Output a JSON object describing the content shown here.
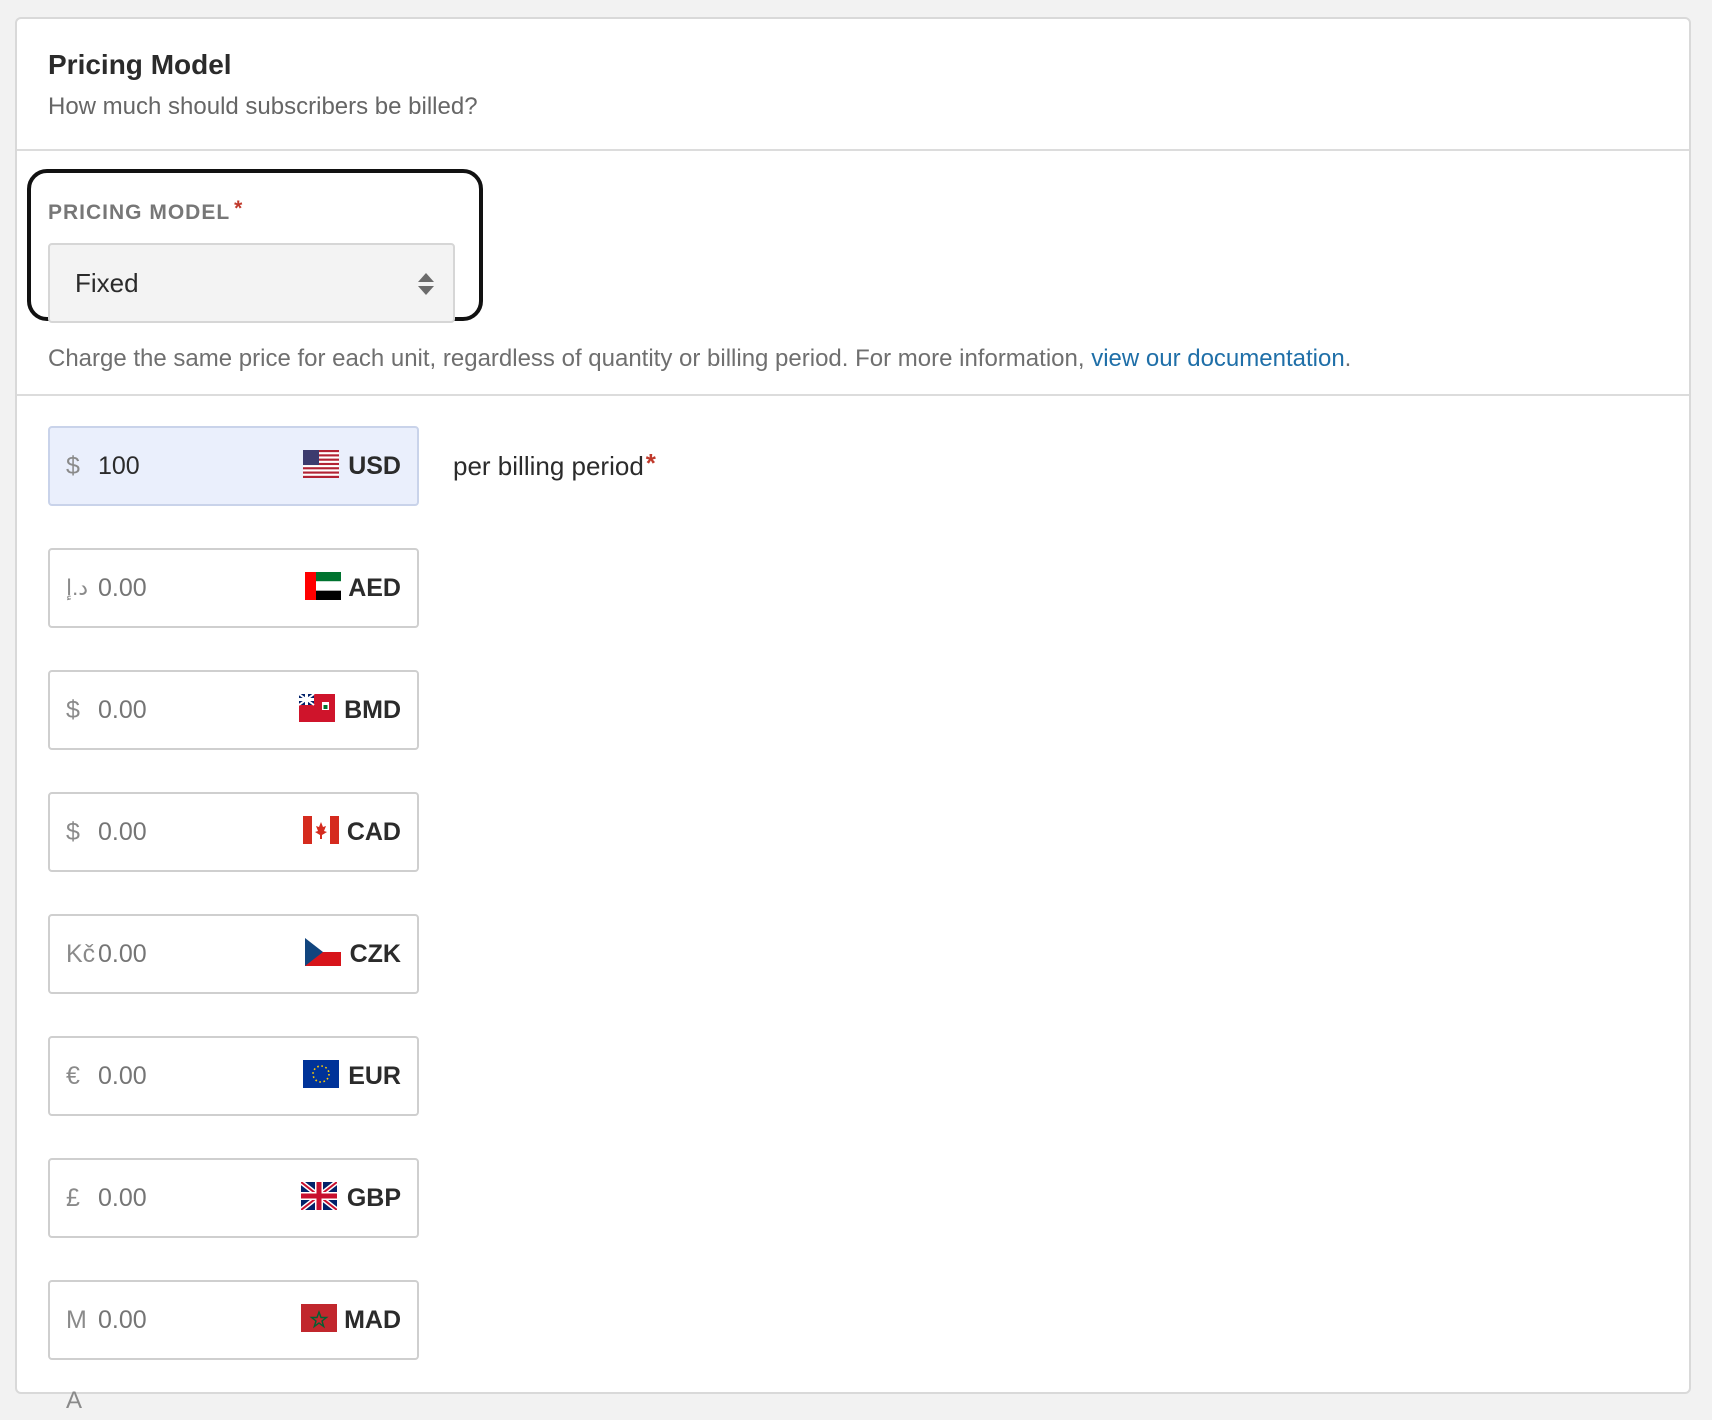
{
  "header": {
    "title": "Pricing Model",
    "subtitle": "How much should subscribers be billed?"
  },
  "pricing_model": {
    "label": "PRICING MODEL",
    "required_mark": "*",
    "selected": "Fixed",
    "help_text": "Charge the same price for each unit, regardless of quantity or billing period. For more information,",
    "help_link": "view our documentation",
    "help_end": "."
  },
  "prices": {
    "period_label": "per billing period",
    "required_mark": "*",
    "rows": [
      {
        "symbol": "$",
        "value": "100",
        "placeholder": "0.00",
        "code": "USD",
        "flag": "us-flag-icon"
      },
      {
        "symbol": "د.إ",
        "value": "",
        "placeholder": "0.00",
        "code": "AED",
        "flag": "ae-flag-icon"
      },
      {
        "symbol": "$",
        "value": "",
        "placeholder": "0.00",
        "code": "BMD",
        "flag": "bm-flag-icon"
      },
      {
        "symbol": "$",
        "value": "",
        "placeholder": "0.00",
        "code": "CAD",
        "flag": "ca-flag-icon"
      },
      {
        "symbol": "Kč",
        "value": "",
        "placeholder": "0.00",
        "code": "CZK",
        "flag": "cz-flag-icon"
      },
      {
        "symbol": "€",
        "value": "",
        "placeholder": "0.00",
        "code": "EUR",
        "flag": "eu-flag-icon"
      },
      {
        "symbol": "£",
        "value": "",
        "placeholder": "0.00",
        "code": "GBP",
        "flag": "gb-flag-icon"
      },
      {
        "symbol": "M",
        "value": "",
        "placeholder": "0.00",
        "code": "MAD",
        "flag": "ma-flag-icon"
      }
    ],
    "overflow_text": "A"
  },
  "colors": {
    "accent_link": "#1f6fa8",
    "required": "#c0392b",
    "active_input_bg": "#eaeffc"
  }
}
